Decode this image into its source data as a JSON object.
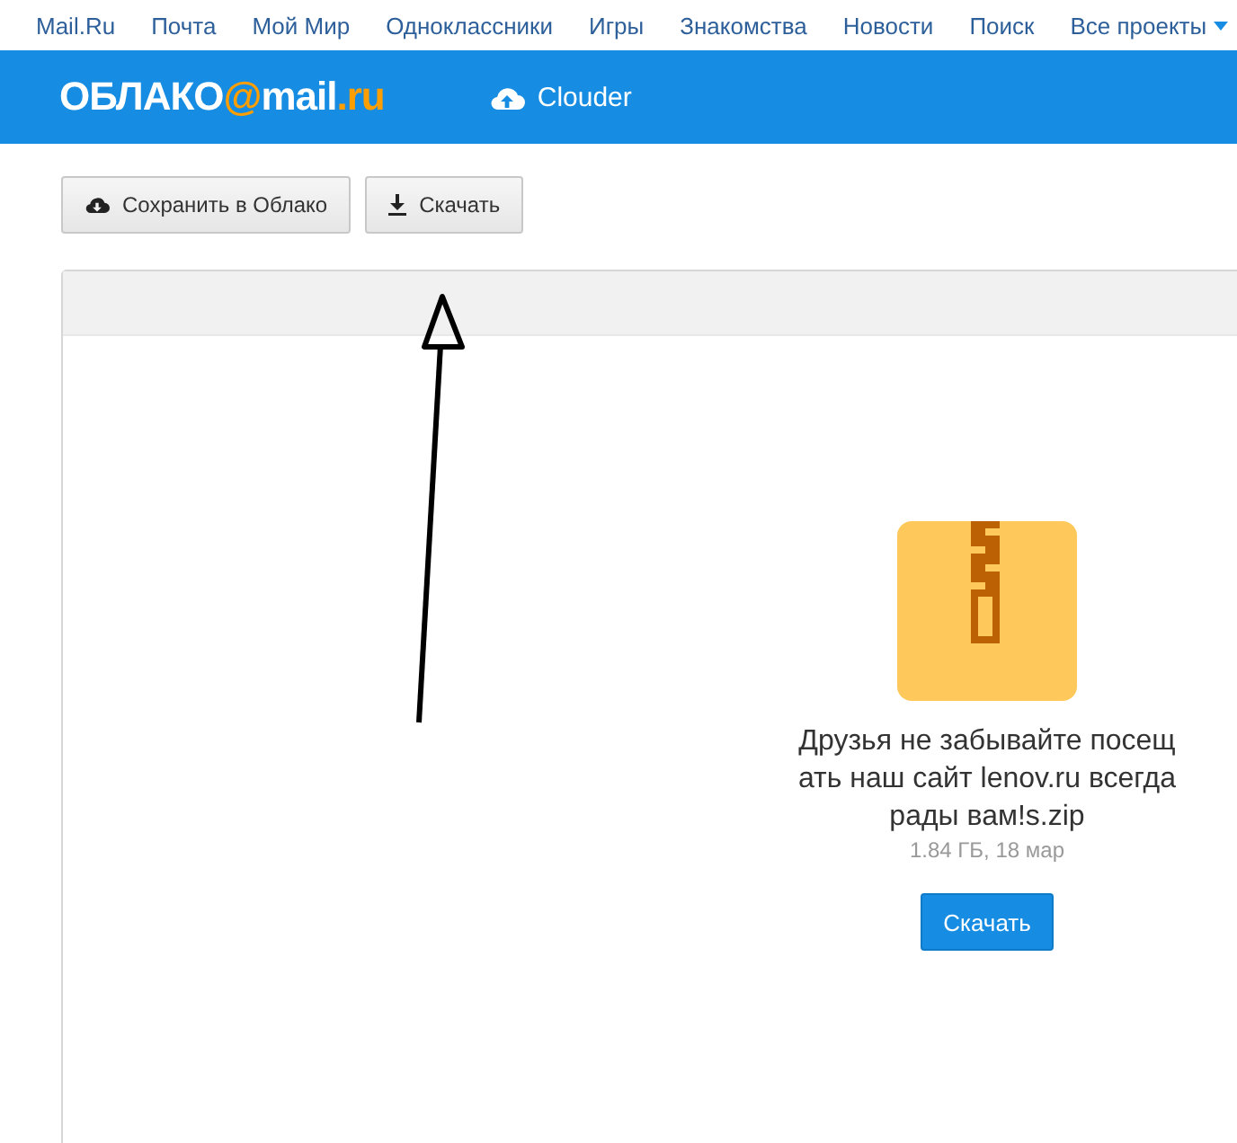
{
  "top_nav": [
    "Mail.Ru",
    "Почта",
    "Мой Мир",
    "Одноклассники",
    "Игры",
    "Знакомства",
    "Новости",
    "Поиск",
    "Все проекты"
  ],
  "header": {
    "logo_prefix": "ОБЛАКО",
    "logo_at": "@",
    "logo_mail": "mail",
    "logo_dot": ".",
    "logo_ru": "ru",
    "user": "Clouder"
  },
  "toolbar": [
    {
      "kind": "cloud",
      "label": "Сохранить в Облако"
    },
    {
      "kind": "download",
      "label": "Скачать"
    }
  ],
  "file": {
    "name_lines": [
      "Друзья не забывайте посещ",
      "ать наш сайт lenov.ru всегда",
      "рады вам!s.zip"
    ],
    "meta": "1.84 ГБ, 18 мар",
    "button": "Скачать"
  }
}
